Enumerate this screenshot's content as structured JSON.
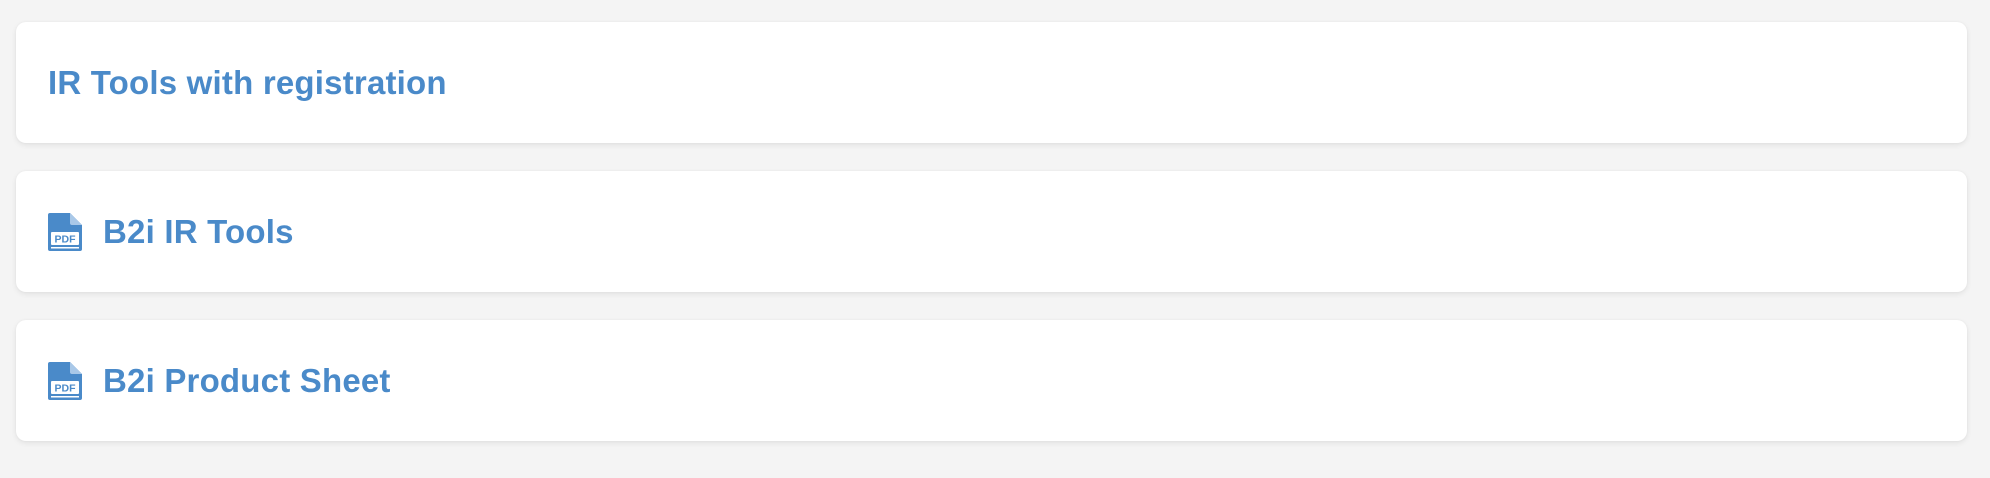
{
  "accent_color": "#4a8ac9",
  "items": [
    {
      "label": "IR Tools with registration",
      "icon": null
    },
    {
      "label": "B2i IR Tools",
      "icon": "pdf-file-icon",
      "icon_text": "PDF"
    },
    {
      "label": "B2i Product Sheet",
      "icon": "pdf-file-icon",
      "icon_text": "PDF"
    }
  ]
}
